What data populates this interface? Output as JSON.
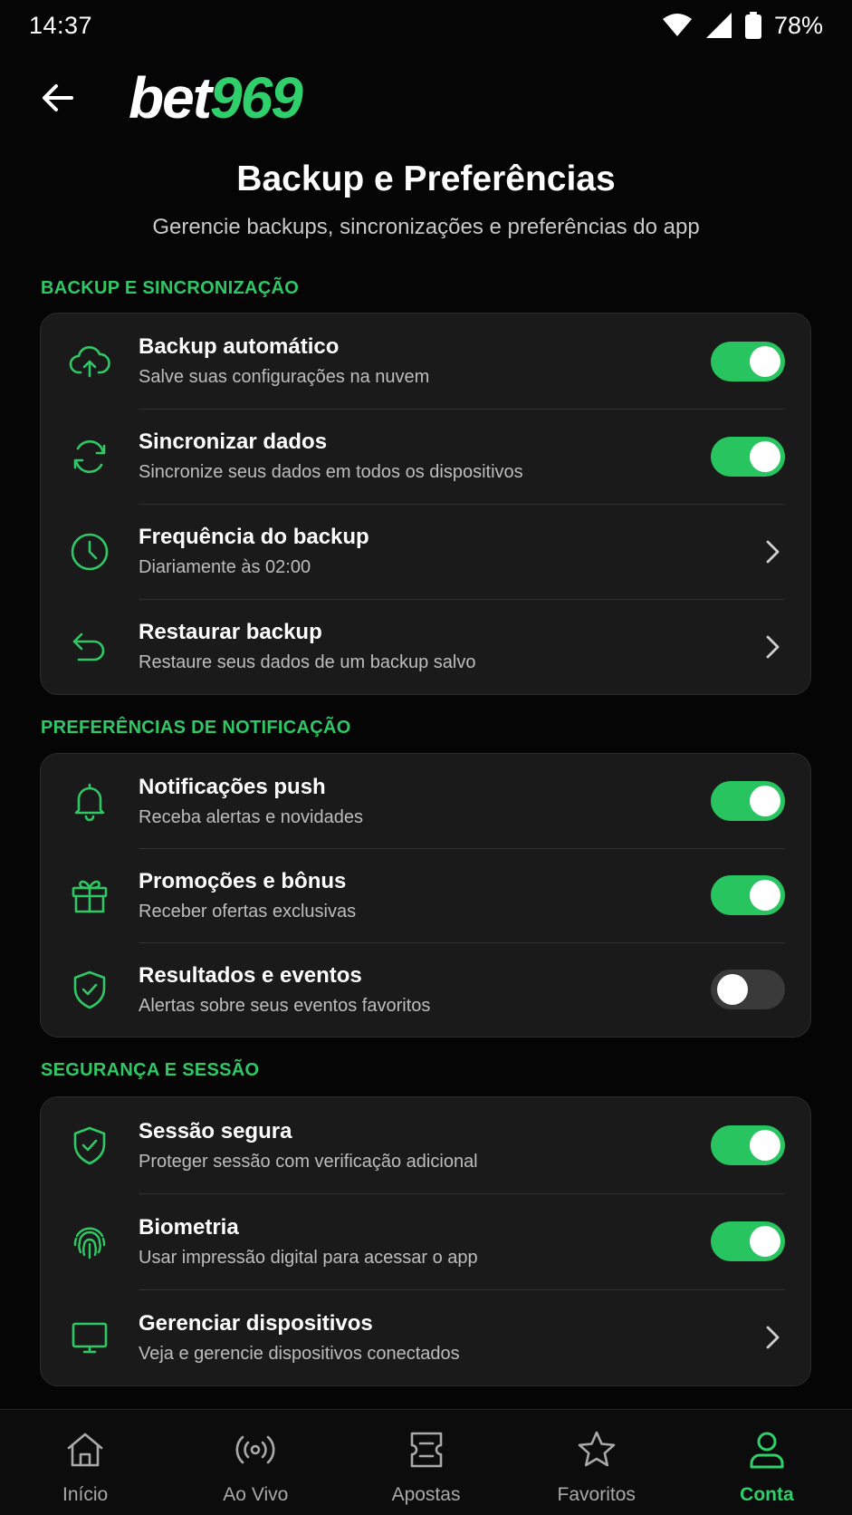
{
  "status_bar": {
    "time": "14:37",
    "battery": "78%"
  },
  "header": {
    "logo_white": "bet",
    "logo_green": "969"
  },
  "page": {
    "title": "Backup e Preferências",
    "subtitle": "Gerencie backups, sincronizações e preferências do app"
  },
  "sections": [
    {
      "label": "BACKUP E SINCRONIZAÇÃO",
      "rows": [
        {
          "title": "Backup automático",
          "subtitle": "Salve suas configurações na nuvem",
          "control": "toggle",
          "on": true,
          "icon": "cloud-upload-icon"
        },
        {
          "title": "Sincronizar dados",
          "subtitle": "Sincronize seus dados em todos os dispositivos",
          "control": "toggle",
          "on": true,
          "icon": "sync-icon"
        },
        {
          "title": "Frequência do backup",
          "subtitle": "Diariamente às 02:00",
          "control": "chevron",
          "icon": "clock-icon"
        },
        {
          "title": "Restaurar backup",
          "subtitle": "Restaure seus dados de um backup salvo",
          "control": "chevron",
          "icon": "undo-arrow-icon"
        }
      ]
    },
    {
      "label": "PREFERÊNCIAS DE NOTIFICAÇÃO",
      "rows": [
        {
          "title": "Notificações push",
          "subtitle": "Receba alertas e novidades",
          "control": "toggle",
          "on": true,
          "icon": "bell-icon"
        },
        {
          "title": "Promoções e bônus",
          "subtitle": "Receber ofertas exclusivas",
          "control": "toggle",
          "on": true,
          "icon": "gift-icon"
        },
        {
          "title": "Resultados e eventos",
          "subtitle": "Alertas sobre seus eventos favoritos",
          "control": "toggle",
          "on": false,
          "icon": "shield-check-icon"
        }
      ]
    },
    {
      "label": "SEGURANÇA E SESSÃO",
      "rows": [
        {
          "title": "Sessão segura",
          "subtitle": "Proteger sessão com verificação adicional",
          "control": "toggle",
          "on": true,
          "icon": "shield-check-icon"
        },
        {
          "title": "Biometria",
          "subtitle": "Usar impressão digital para acessar o app",
          "control": "toggle",
          "on": true,
          "icon": "fingerprint-icon"
        },
        {
          "title": "Gerenciar dispositivos",
          "subtitle": "Veja e gerencie dispositivos conectados",
          "control": "chevron",
          "icon": "monitor-icon"
        }
      ]
    }
  ],
  "bottom_nav": [
    {
      "label": "Início",
      "icon": "home-icon",
      "active": false
    },
    {
      "label": "Ao Vivo",
      "icon": "live-broadcast-icon",
      "active": false
    },
    {
      "label": "Apostas",
      "icon": "ticket-icon",
      "active": false
    },
    {
      "label": "Favoritos",
      "icon": "star-icon",
      "active": false
    },
    {
      "label": "Conta",
      "icon": "user-icon",
      "active": true
    }
  ],
  "colors": {
    "accent": "#2fd06b",
    "background": "#050505",
    "card": "#1a1a1a"
  }
}
